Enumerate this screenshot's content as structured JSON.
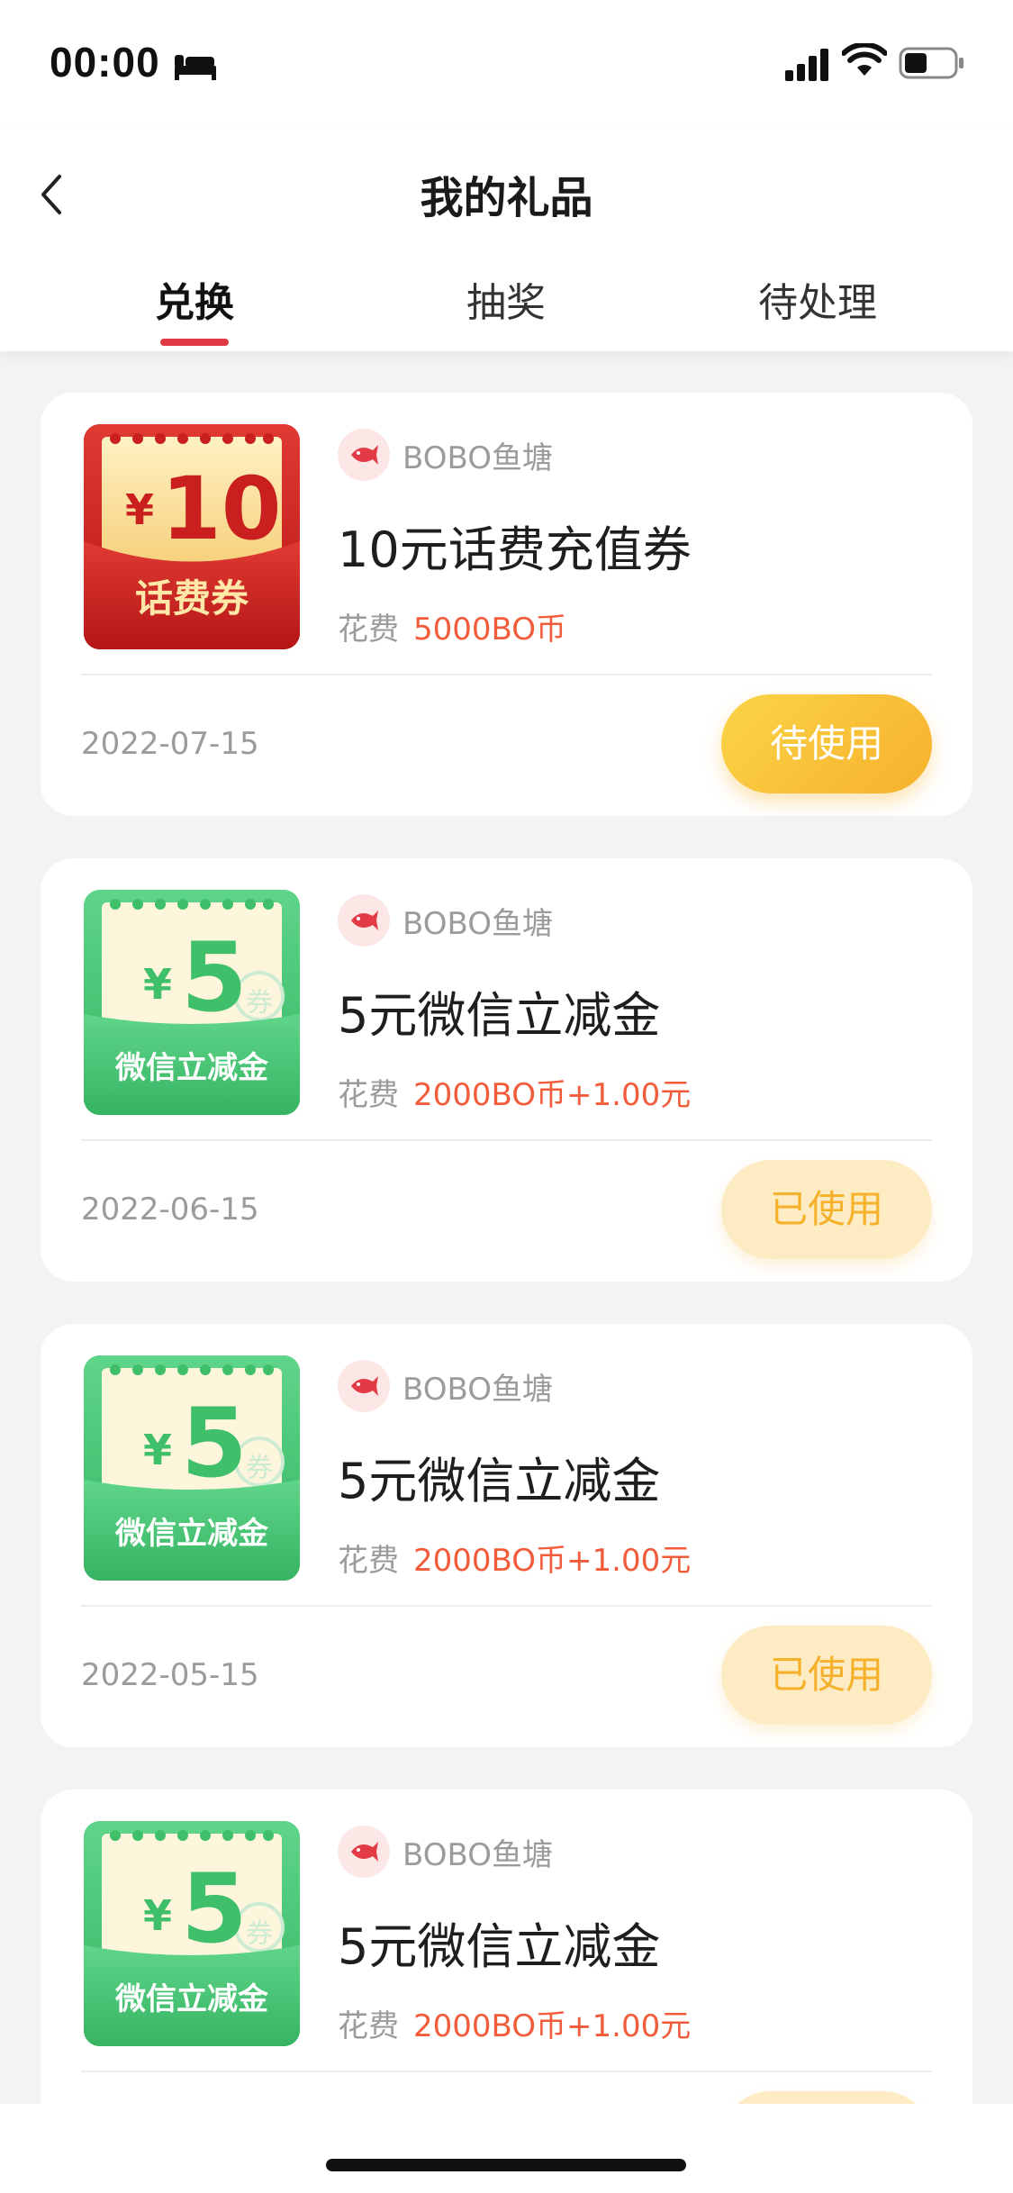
{
  "status_bar": {
    "time": "00:00"
  },
  "header": {
    "title": "我的礼品"
  },
  "tabs": [
    {
      "label": "兑换"
    },
    {
      "label": "抽奖"
    },
    {
      "label": "待处理"
    }
  ],
  "thumbs": {
    "phone": {
      "currency": "¥",
      "amount": "10",
      "label": "话费券"
    },
    "wechat": {
      "currency": "¥",
      "amount": "5",
      "label": "微信立减金",
      "stamp": "券"
    }
  },
  "cost_label": "花费",
  "gifts": [
    {
      "shop": "BOBO鱼塘",
      "name": "10元话费充值券",
      "cost": "5000BO币",
      "date": "2022-07-15",
      "status": "待使用"
    },
    {
      "shop": "BOBO鱼塘",
      "name": "5元微信立减金",
      "cost": "2000BO币+1.00元",
      "date": "2022-06-15",
      "status": "已使用"
    },
    {
      "shop": "BOBO鱼塘",
      "name": "5元微信立减金",
      "cost": "2000BO币+1.00元",
      "date": "2022-05-15",
      "status": "已使用"
    },
    {
      "shop": "BOBO鱼塘",
      "name": "5元微信立减金",
      "cost": "2000BO币+1.00元"
    }
  ],
  "colors": {
    "accent_red": "#e23b45",
    "cost_orange": "#f25c3b",
    "pending_yellow": "#f6b12b",
    "used_bg": "#fdebc4"
  },
  "icons": [
    "bed-icon",
    "signal-icon",
    "wifi-icon",
    "battery-icon",
    "back-icon",
    "fish-logo-icon"
  ]
}
